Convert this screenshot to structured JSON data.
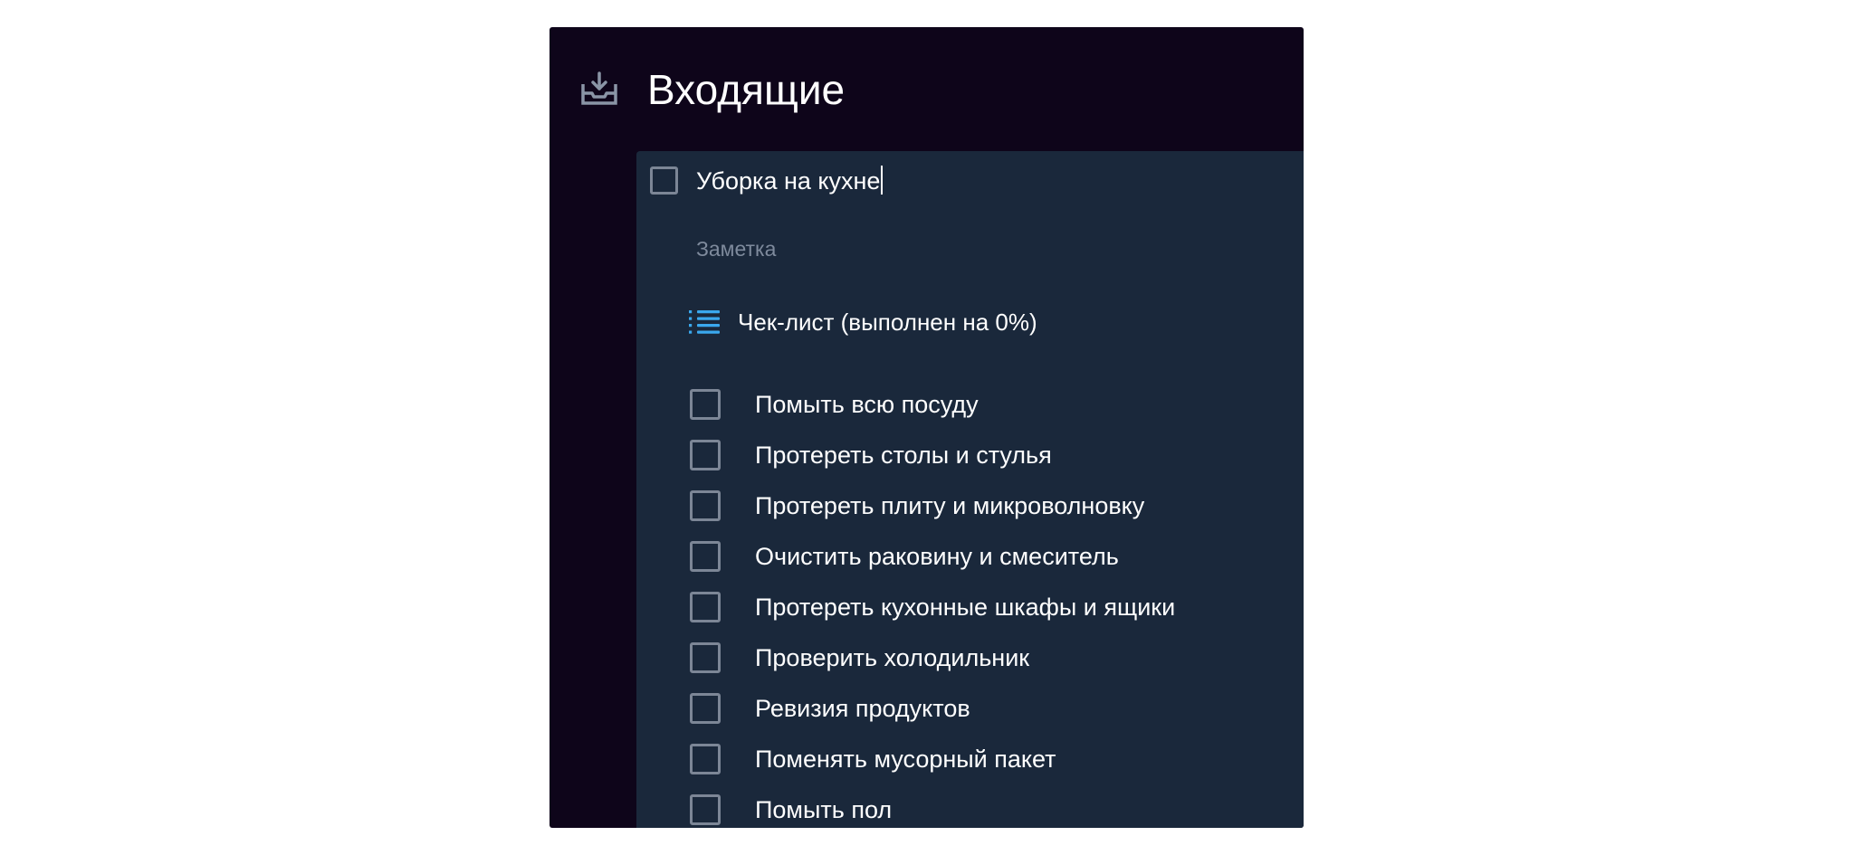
{
  "header": {
    "title": "Входящие",
    "icon": "inbox-download-icon"
  },
  "task": {
    "title": "Уборка на кухне",
    "checked": false,
    "note_placeholder": "Заметка"
  },
  "checklist": {
    "icon": "checklist-icon",
    "header": "Чек-лист (выполнен на 0%)",
    "progress_percent": 0,
    "items": [
      {
        "label": "Помыть всю посуду",
        "checked": false
      },
      {
        "label": "Протереть столы и стулья",
        "checked": false
      },
      {
        "label": "Протереть плиту и микроволновку",
        "checked": false
      },
      {
        "label": "Очистить раковину и смеситель",
        "checked": false
      },
      {
        "label": "Протереть кухонные шкафы и ящики",
        "checked": false
      },
      {
        "label": "Проверить холодильник",
        "checked": false
      },
      {
        "label": "Ревизия продуктов",
        "checked": false
      },
      {
        "label": "Поменять мусорный пакет",
        "checked": false
      },
      {
        "label": "Помыть пол",
        "checked": false
      }
    ]
  },
  "colors": {
    "window_bg": "#0e051a",
    "panel_bg": "#1a283b",
    "checkbox_border": "#7c8696",
    "accent": "#3aa8ee",
    "muted_text": "#7e8a9c",
    "text": "#ffffff"
  }
}
